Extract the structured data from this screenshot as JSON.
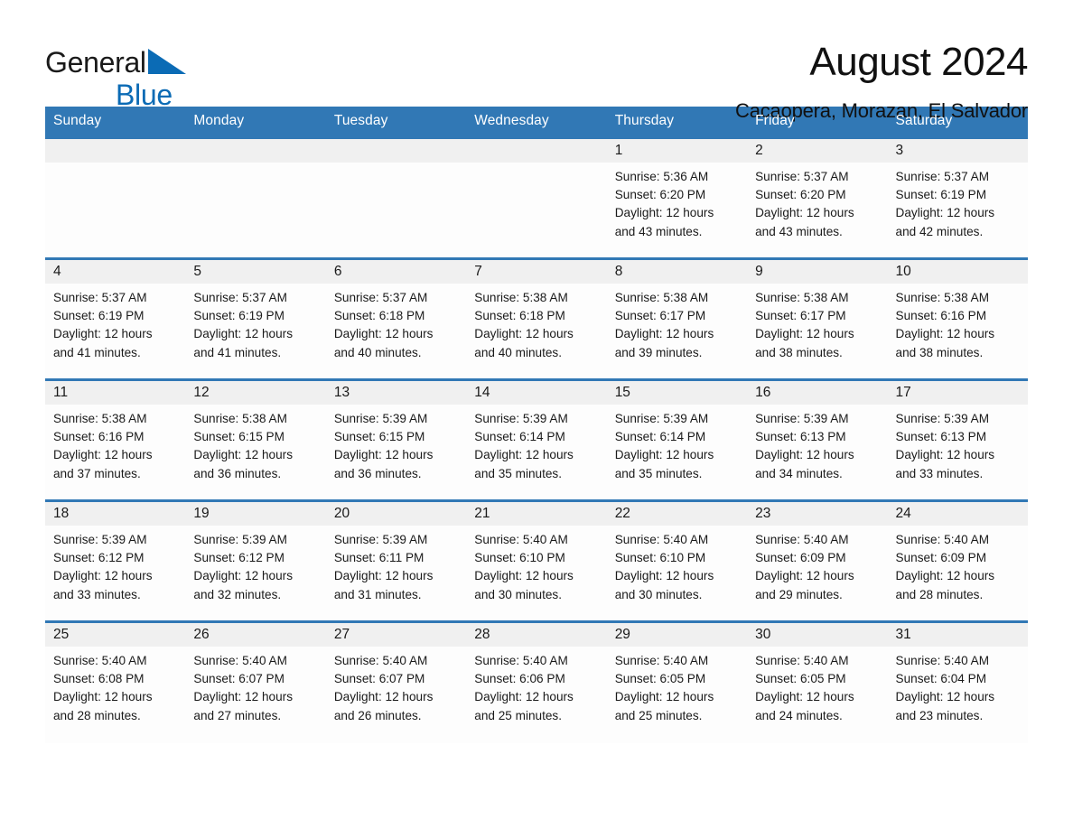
{
  "brand": {
    "name_part1": "General",
    "name_part2": "Blue",
    "triangle_color": "#0b6bb5"
  },
  "header": {
    "title": "August 2024",
    "subtitle": "Cacaopera, Morazan, El Salvador"
  },
  "theme": {
    "header_blue": "#3178b5",
    "day_band_gray": "#f0f0f0",
    "cell_background": "#fdfdfd",
    "text_color": "#1a1a1a"
  },
  "calendar": {
    "weekdays": [
      "Sunday",
      "Monday",
      "Tuesday",
      "Wednesday",
      "Thursday",
      "Friday",
      "Saturday"
    ],
    "weeks": [
      [
        {
          "day": "",
          "empty": true,
          "sunrise": "",
          "sunset": "",
          "daylight_line1": "",
          "daylight_line2": ""
        },
        {
          "day": "",
          "empty": true,
          "sunrise": "",
          "sunset": "",
          "daylight_line1": "",
          "daylight_line2": ""
        },
        {
          "day": "",
          "empty": true,
          "sunrise": "",
          "sunset": "",
          "daylight_line1": "",
          "daylight_line2": ""
        },
        {
          "day": "",
          "empty": true,
          "sunrise": "",
          "sunset": "",
          "daylight_line1": "",
          "daylight_line2": ""
        },
        {
          "day": "1",
          "empty": false,
          "sunrise": "Sunrise: 5:36 AM",
          "sunset": "Sunset: 6:20 PM",
          "daylight_line1": "Daylight: 12 hours",
          "daylight_line2": "and 43 minutes."
        },
        {
          "day": "2",
          "empty": false,
          "sunrise": "Sunrise: 5:37 AM",
          "sunset": "Sunset: 6:20 PM",
          "daylight_line1": "Daylight: 12 hours",
          "daylight_line2": "and 43 minutes."
        },
        {
          "day": "3",
          "empty": false,
          "sunrise": "Sunrise: 5:37 AM",
          "sunset": "Sunset: 6:19 PM",
          "daylight_line1": "Daylight: 12 hours",
          "daylight_line2": "and 42 minutes."
        }
      ],
      [
        {
          "day": "4",
          "empty": false,
          "sunrise": "Sunrise: 5:37 AM",
          "sunset": "Sunset: 6:19 PM",
          "daylight_line1": "Daylight: 12 hours",
          "daylight_line2": "and 41 minutes."
        },
        {
          "day": "5",
          "empty": false,
          "sunrise": "Sunrise: 5:37 AM",
          "sunset": "Sunset: 6:19 PM",
          "daylight_line1": "Daylight: 12 hours",
          "daylight_line2": "and 41 minutes."
        },
        {
          "day": "6",
          "empty": false,
          "sunrise": "Sunrise: 5:37 AM",
          "sunset": "Sunset: 6:18 PM",
          "daylight_line1": "Daylight: 12 hours",
          "daylight_line2": "and 40 minutes."
        },
        {
          "day": "7",
          "empty": false,
          "sunrise": "Sunrise: 5:38 AM",
          "sunset": "Sunset: 6:18 PM",
          "daylight_line1": "Daylight: 12 hours",
          "daylight_line2": "and 40 minutes."
        },
        {
          "day": "8",
          "empty": false,
          "sunrise": "Sunrise: 5:38 AM",
          "sunset": "Sunset: 6:17 PM",
          "daylight_line1": "Daylight: 12 hours",
          "daylight_line2": "and 39 minutes."
        },
        {
          "day": "9",
          "empty": false,
          "sunrise": "Sunrise: 5:38 AM",
          "sunset": "Sunset: 6:17 PM",
          "daylight_line1": "Daylight: 12 hours",
          "daylight_line2": "and 38 minutes."
        },
        {
          "day": "10",
          "empty": false,
          "sunrise": "Sunrise: 5:38 AM",
          "sunset": "Sunset: 6:16 PM",
          "daylight_line1": "Daylight: 12 hours",
          "daylight_line2": "and 38 minutes."
        }
      ],
      [
        {
          "day": "11",
          "empty": false,
          "sunrise": "Sunrise: 5:38 AM",
          "sunset": "Sunset: 6:16 PM",
          "daylight_line1": "Daylight: 12 hours",
          "daylight_line2": "and 37 minutes."
        },
        {
          "day": "12",
          "empty": false,
          "sunrise": "Sunrise: 5:38 AM",
          "sunset": "Sunset: 6:15 PM",
          "daylight_line1": "Daylight: 12 hours",
          "daylight_line2": "and 36 minutes."
        },
        {
          "day": "13",
          "empty": false,
          "sunrise": "Sunrise: 5:39 AM",
          "sunset": "Sunset: 6:15 PM",
          "daylight_line1": "Daylight: 12 hours",
          "daylight_line2": "and 36 minutes."
        },
        {
          "day": "14",
          "empty": false,
          "sunrise": "Sunrise: 5:39 AM",
          "sunset": "Sunset: 6:14 PM",
          "daylight_line1": "Daylight: 12 hours",
          "daylight_line2": "and 35 minutes."
        },
        {
          "day": "15",
          "empty": false,
          "sunrise": "Sunrise: 5:39 AM",
          "sunset": "Sunset: 6:14 PM",
          "daylight_line1": "Daylight: 12 hours",
          "daylight_line2": "and 35 minutes."
        },
        {
          "day": "16",
          "empty": false,
          "sunrise": "Sunrise: 5:39 AM",
          "sunset": "Sunset: 6:13 PM",
          "daylight_line1": "Daylight: 12 hours",
          "daylight_line2": "and 34 minutes."
        },
        {
          "day": "17",
          "empty": false,
          "sunrise": "Sunrise: 5:39 AM",
          "sunset": "Sunset: 6:13 PM",
          "daylight_line1": "Daylight: 12 hours",
          "daylight_line2": "and 33 minutes."
        }
      ],
      [
        {
          "day": "18",
          "empty": false,
          "sunrise": "Sunrise: 5:39 AM",
          "sunset": "Sunset: 6:12 PM",
          "daylight_line1": "Daylight: 12 hours",
          "daylight_line2": "and 33 minutes."
        },
        {
          "day": "19",
          "empty": false,
          "sunrise": "Sunrise: 5:39 AM",
          "sunset": "Sunset: 6:12 PM",
          "daylight_line1": "Daylight: 12 hours",
          "daylight_line2": "and 32 minutes."
        },
        {
          "day": "20",
          "empty": false,
          "sunrise": "Sunrise: 5:39 AM",
          "sunset": "Sunset: 6:11 PM",
          "daylight_line1": "Daylight: 12 hours",
          "daylight_line2": "and 31 minutes."
        },
        {
          "day": "21",
          "empty": false,
          "sunrise": "Sunrise: 5:40 AM",
          "sunset": "Sunset: 6:10 PM",
          "daylight_line1": "Daylight: 12 hours",
          "daylight_line2": "and 30 minutes."
        },
        {
          "day": "22",
          "empty": false,
          "sunrise": "Sunrise: 5:40 AM",
          "sunset": "Sunset: 6:10 PM",
          "daylight_line1": "Daylight: 12 hours",
          "daylight_line2": "and 30 minutes."
        },
        {
          "day": "23",
          "empty": false,
          "sunrise": "Sunrise: 5:40 AM",
          "sunset": "Sunset: 6:09 PM",
          "daylight_line1": "Daylight: 12 hours",
          "daylight_line2": "and 29 minutes."
        },
        {
          "day": "24",
          "empty": false,
          "sunrise": "Sunrise: 5:40 AM",
          "sunset": "Sunset: 6:09 PM",
          "daylight_line1": "Daylight: 12 hours",
          "daylight_line2": "and 28 minutes."
        }
      ],
      [
        {
          "day": "25",
          "empty": false,
          "sunrise": "Sunrise: 5:40 AM",
          "sunset": "Sunset: 6:08 PM",
          "daylight_line1": "Daylight: 12 hours",
          "daylight_line2": "and 28 minutes."
        },
        {
          "day": "26",
          "empty": false,
          "sunrise": "Sunrise: 5:40 AM",
          "sunset": "Sunset: 6:07 PM",
          "daylight_line1": "Daylight: 12 hours",
          "daylight_line2": "and 27 minutes."
        },
        {
          "day": "27",
          "empty": false,
          "sunrise": "Sunrise: 5:40 AM",
          "sunset": "Sunset: 6:07 PM",
          "daylight_line1": "Daylight: 12 hours",
          "daylight_line2": "and 26 minutes."
        },
        {
          "day": "28",
          "empty": false,
          "sunrise": "Sunrise: 5:40 AM",
          "sunset": "Sunset: 6:06 PM",
          "daylight_line1": "Daylight: 12 hours",
          "daylight_line2": "and 25 minutes."
        },
        {
          "day": "29",
          "empty": false,
          "sunrise": "Sunrise: 5:40 AM",
          "sunset": "Sunset: 6:05 PM",
          "daylight_line1": "Daylight: 12 hours",
          "daylight_line2": "and 25 minutes."
        },
        {
          "day": "30",
          "empty": false,
          "sunrise": "Sunrise: 5:40 AM",
          "sunset": "Sunset: 6:05 PM",
          "daylight_line1": "Daylight: 12 hours",
          "daylight_line2": "and 24 minutes."
        },
        {
          "day": "31",
          "empty": false,
          "sunrise": "Sunrise: 5:40 AM",
          "sunset": "Sunset: 6:04 PM",
          "daylight_line1": "Daylight: 12 hours",
          "daylight_line2": "and 23 minutes."
        }
      ]
    ]
  }
}
